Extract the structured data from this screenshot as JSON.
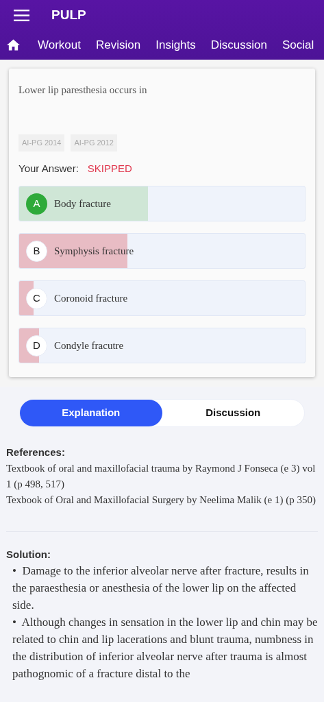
{
  "app_bar": {
    "title": "PULP"
  },
  "nav_tabs": [
    "Workout",
    "Revision",
    "Insights",
    "Discussion",
    "Social"
  ],
  "question": {
    "text": "Lower lip paresthesia occurs in",
    "tags": [
      "AI-PG 2014",
      "AI-PG 2012"
    ],
    "answer_label": "Your Answer:",
    "answer_value": "SKIPPED",
    "options": [
      {
        "letter": "A",
        "text": "Body fracture",
        "kind": "correct",
        "level": 0.45
      },
      {
        "letter": "B",
        "text": "Symphysis fracture",
        "kind": "wrong",
        "level": 0.38
      },
      {
        "letter": "C",
        "text": "Coronoid fracture",
        "kind": "wrong",
        "level": 0.05
      },
      {
        "letter": "D",
        "text": "Condyle fracutre",
        "kind": "wrong",
        "level": 0.07
      }
    ]
  },
  "segments": [
    {
      "label": "Explanation",
      "selected": true
    },
    {
      "label": "Discussion",
      "selected": false
    }
  ],
  "references": {
    "heading": "References:",
    "items": [
      "Textbook of oral and maxillofacial trauma by Raymond J Fonseca (e 3) vol 1 (p 498, 517)",
      "Texbook of Oral and Maxillofacial Surgery by Neelima Malik (e 1) (p 350)"
    ]
  },
  "solution": {
    "heading": "Solution:",
    "bullets": [
      "•  Damage to the inferior alveolar nerve after fracture, results in the paraesthesia or anesthesia of the lower lip on the affected side.",
      "•  Although changes in sensation in the lower lip and chin may be related to chin and lip lacerations and blunt trauma, numbness in the distribution of inferior alveolar nerve after trauma is almost pathognomic of a fracture distal to the"
    ]
  }
}
